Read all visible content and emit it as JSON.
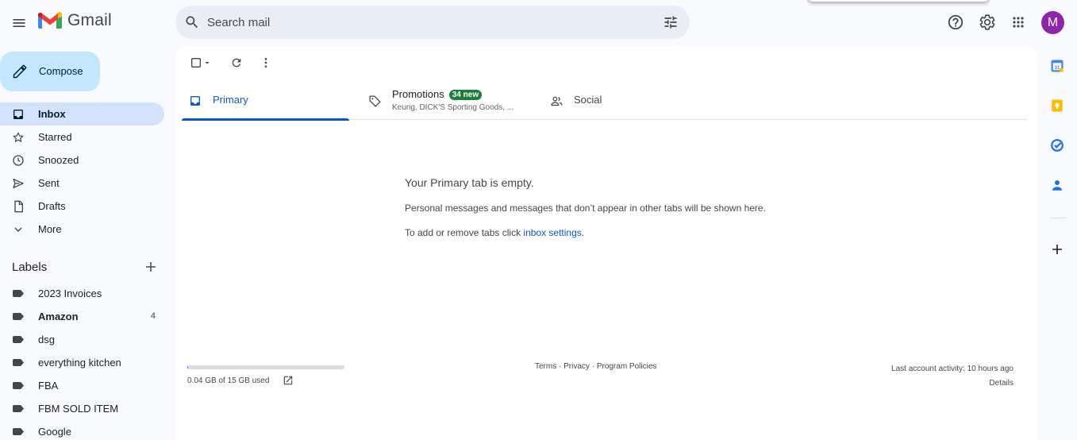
{
  "header": {
    "app_name": "Gmail",
    "search_placeholder": "Search mail",
    "avatar_initial": "M",
    "avatar_color": "#8e24aa"
  },
  "compose": {
    "label": "Compose"
  },
  "nav": {
    "items": [
      {
        "label": "Inbox",
        "icon": "inbox-icon",
        "active": true
      },
      {
        "label": "Starred",
        "icon": "star-icon"
      },
      {
        "label": "Snoozed",
        "icon": "clock-icon"
      },
      {
        "label": "Sent",
        "icon": "send-icon"
      },
      {
        "label": "Drafts",
        "icon": "draft-icon"
      },
      {
        "label": "More",
        "icon": "chevron-down-icon"
      }
    ]
  },
  "labels": {
    "title": "Labels",
    "items": [
      {
        "label": "2023 Invoices",
        "count": ""
      },
      {
        "label": "Amazon",
        "count": "4",
        "bold": true
      },
      {
        "label": "dsg",
        "count": ""
      },
      {
        "label": "everything kitchen",
        "count": ""
      },
      {
        "label": "FBA",
        "count": ""
      },
      {
        "label": "FBM SOLD ITEM",
        "count": ""
      },
      {
        "label": "Google",
        "count": ""
      }
    ]
  },
  "tabs": {
    "primary": {
      "label": "Primary"
    },
    "promotions": {
      "label": "Promotions",
      "badge": "34 new",
      "snippet": "Keurig, DICK'S Sporting Goods, ..."
    },
    "social": {
      "label": "Social"
    }
  },
  "empty_state": {
    "heading": "Your Primary tab is empty.",
    "line1": "Personal messages and messages that don’t appear in other tabs will be shown here.",
    "line2_prefix": "To add or remove tabs click ",
    "line2_link": "inbox settings",
    "line2_suffix": "."
  },
  "footer": {
    "storage_text": "0.04 GB of 15 GB used",
    "storage_fraction": 0.0027,
    "terms": "Terms",
    "privacy": "Privacy",
    "program_policies": "Program Policies",
    "separator": " · ",
    "activity": "Last account activity: 10 hours ago",
    "details": "Details"
  },
  "colors": {
    "accent": "#0b57d0",
    "compose_bg": "#c2e7ff",
    "active_nav_bg": "#d3e3fd",
    "badge_green": "#188038"
  }
}
